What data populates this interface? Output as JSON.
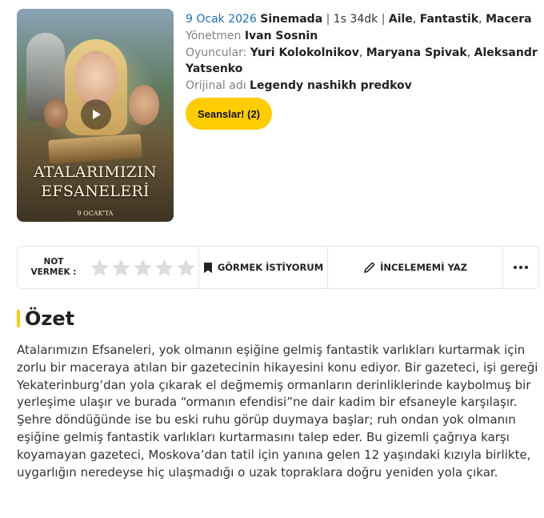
{
  "poster": {
    "title_line1": "ATALARIMIZIN",
    "title_line2": "EFSANELERİ",
    "date_text": "9 OCAK'TA"
  },
  "movie": {
    "release_date": "9 Ocak 2026",
    "release_status": "Sinemada",
    "duration": "1s 34dk",
    "genres": [
      "Aile",
      "Fantastik",
      "Macera"
    ],
    "director_label": "Yönetmen",
    "director": "Ivan Sosnin",
    "cast_label": "Oyuncular:",
    "cast": [
      "Yuri Kolokolnikov",
      "Maryana Spivak",
      "Aleksandr Yatsenko"
    ],
    "original_title_label": "Orijinal adı",
    "original_title": "Legendy nashikh predkov"
  },
  "buttons": {
    "showtimes": "Seanslar! (2)",
    "want_to_see": "GÖRMEK İSTİYORUM",
    "write_review": "İNCELEMEMİ YAZ",
    "rate_label_line1": "NOT",
    "rate_label_line2": "VERMEK :"
  },
  "rating": {
    "filled_stars": 0,
    "total_stars": 5
  },
  "summary": {
    "heading": "Özet",
    "text": "Atalarımızın Efsaneleri, yok olmanın eşiğine gelmiş fantastik varlıkları kurtarmak için zorlu bir maceraya atılan bir gazetecinin hikayesini konu ediyor. Bir gazeteci, işi gereği Yekaterinburg’dan yola çıkarak el değmemiş ormanların derinliklerinde kaybolmuş bir yerleşime ulaşır ve burada “ormanın efendisi”ne dair kadim bir efsaneyle karşılaşır. Şehre döndüğünde ise bu eski ruhu görüp duymaya başlar; ruh ondan yok olmanın eşiğine gelmiş fantastik varlıkları kurtarmasını talep eder. Bu gizemli çağrıya karşı koyamayan gazeteci, Moskova’dan tatil için yanına gelen 12 yaşındaki kızıyla birlikte, uygarlığın neredeyse hiç ulaşmadığı o uzak topraklara doğru yeniden yola çıkar."
  },
  "colors": {
    "accent": "#ffcc00",
    "link": "#1f6fb2"
  }
}
